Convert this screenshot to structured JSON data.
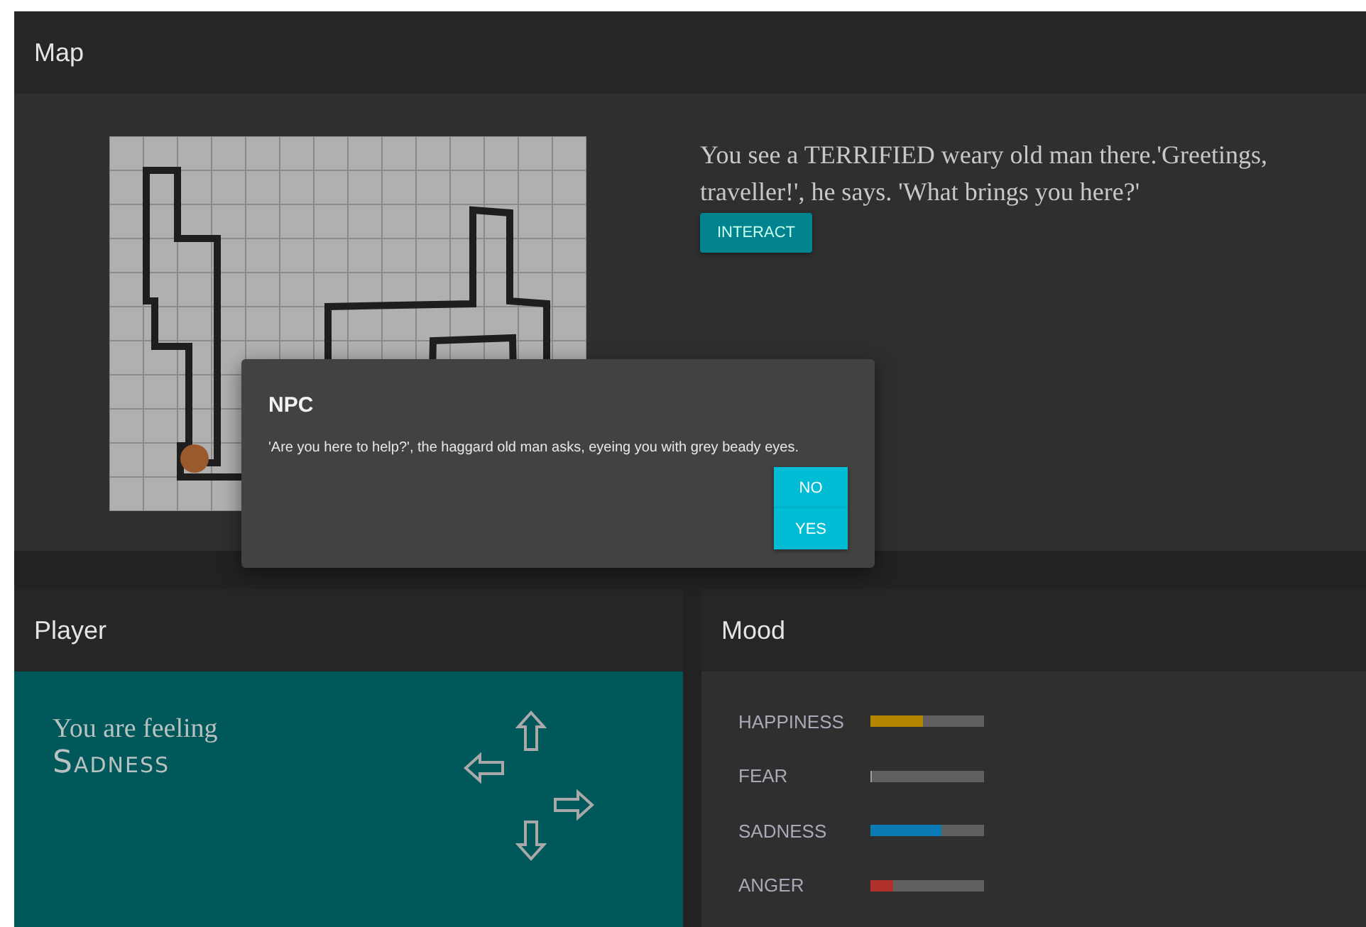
{
  "map_panel": {
    "title": "Map",
    "description": "You see a TERRIFIED weary old man there.'Greetings, traveller!', he says. 'What brings you here?'",
    "interact_button": "INTERACT"
  },
  "dialog": {
    "title": "NPC",
    "message": "'Are you here to help?', the haggard old man asks, eyeing you with grey beady eyes.",
    "buttons": [
      "NO",
      "YES"
    ]
  },
  "player_panel": {
    "title": "Player",
    "feeling_label": "You are feeling",
    "feeling": "Sadness"
  },
  "mood_panel": {
    "title": "Mood",
    "moods": [
      {
        "name": "HAPPINESS",
        "level": 0.46,
        "color": "#b38600"
      },
      {
        "name": "FEAR",
        "level": 0
      },
      {
        "name": "SADNESS",
        "level": 0.62,
        "color": "#0a7bb5"
      },
      {
        "name": "ANGER",
        "level": 0.2,
        "color": "#b0302a"
      }
    ]
  }
}
